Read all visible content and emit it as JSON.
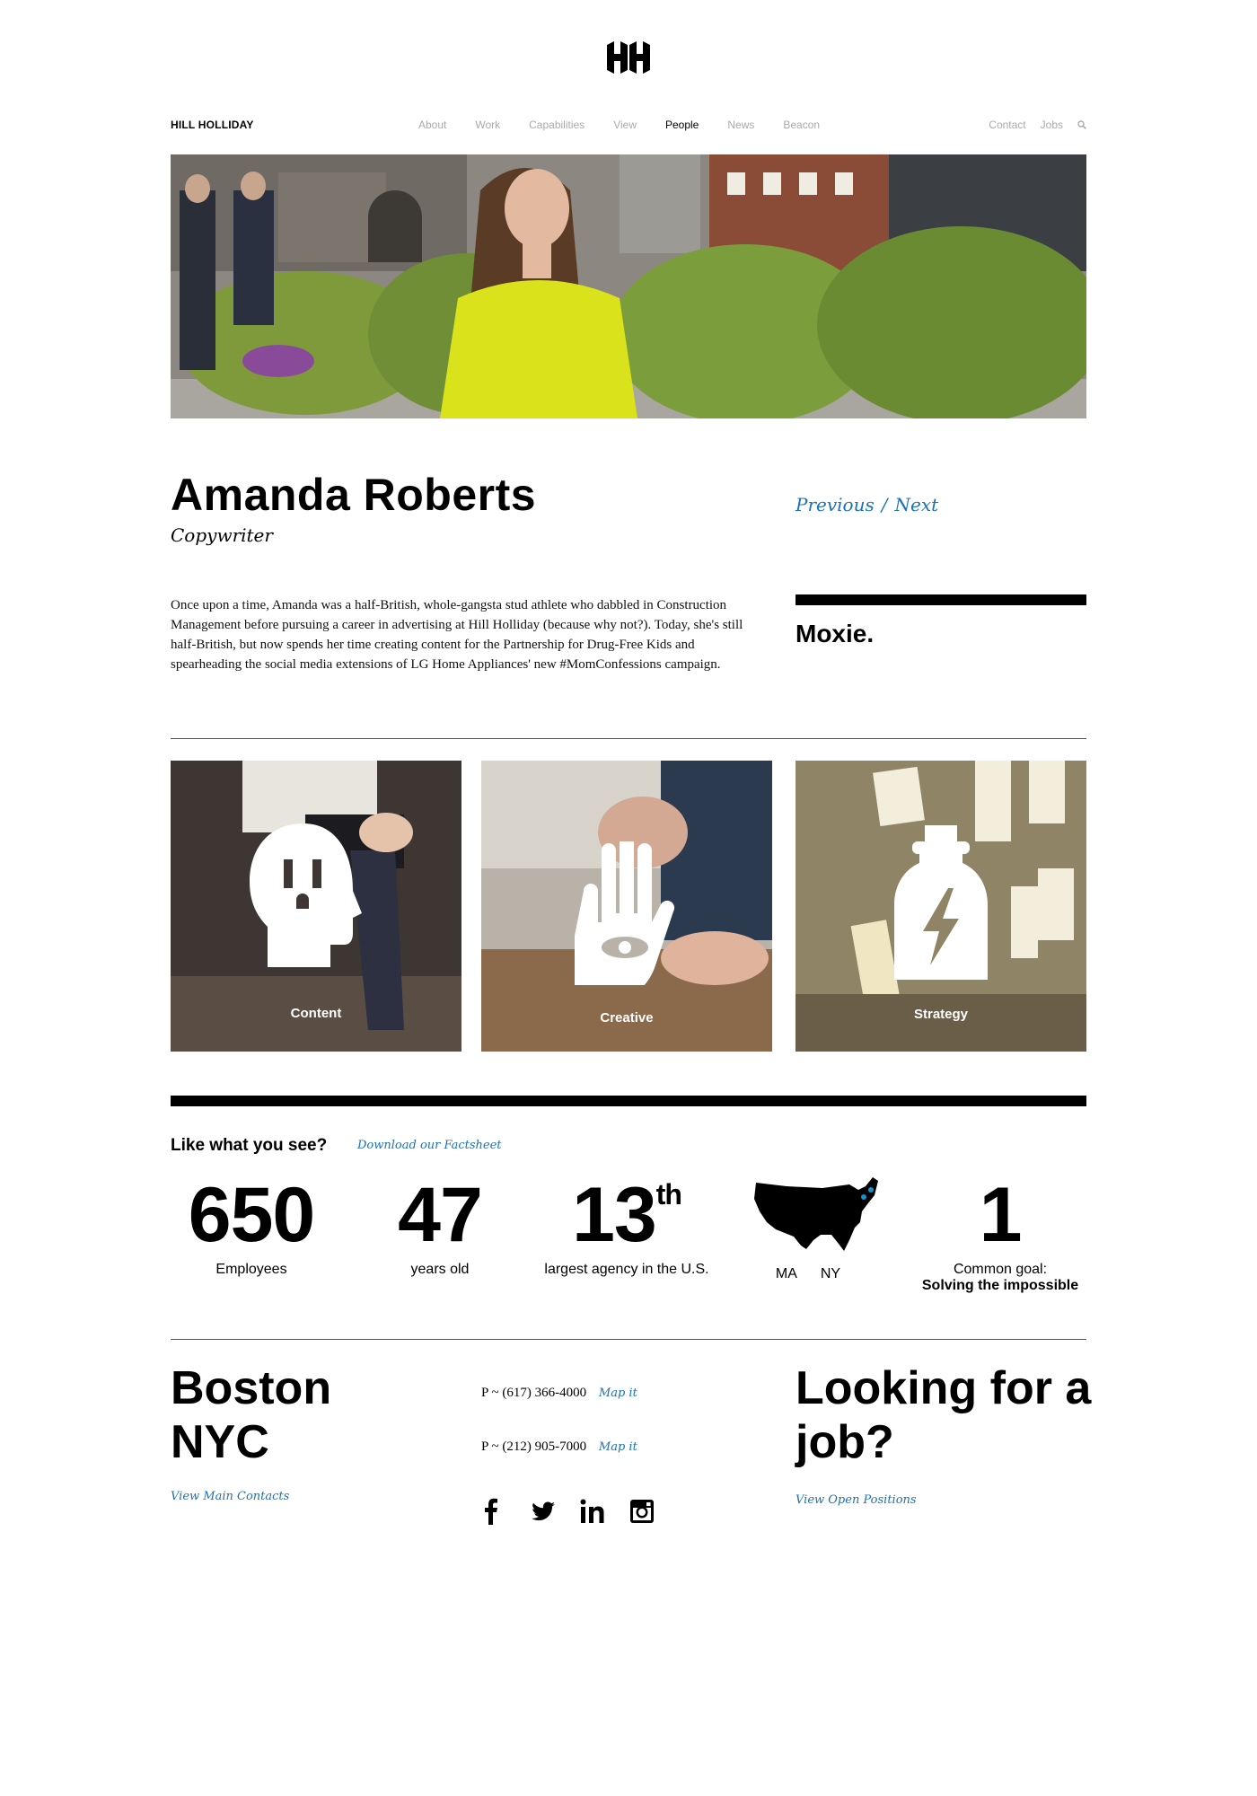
{
  "header": {
    "brand": "HILL HOLLIDAY",
    "nav_main": [
      "About",
      "Work",
      "Capabilities",
      "View",
      "People",
      "News",
      "Beacon"
    ],
    "nav_active": "People",
    "nav_right": [
      "Contact",
      "Jobs"
    ],
    "icons": {
      "logo": "hh-logo-icon",
      "search": "search-icon"
    }
  },
  "profile": {
    "name": "Amanda Roberts",
    "title": "Copywriter",
    "previous_label": "Previous",
    "separator": "/",
    "next_label": "Next",
    "bio": "Once upon a time, Amanda was a half-British, whole-gangsta stud athlete who dabbled in Construction Management before pursuing a career in advertising at Hill Holliday (because why not?). Today, she's still half-British, but now spends her time creating content for the Partnership for Drug-Free Kids and spearheading the social media extensions of LG Home Appliances' new #MomConfessions campaign.",
    "trait": "Moxie."
  },
  "capabilities": [
    {
      "label": "Content",
      "icon": "outlet-head-icon"
    },
    {
      "label": "Creative",
      "icon": "hand-eye-icon"
    },
    {
      "label": "Strategy",
      "icon": "lightning-bottle-icon"
    }
  ],
  "facts": {
    "title": "Like what you see?",
    "download_link": "Download our Factsheet",
    "employees": {
      "value": "650",
      "label": "Employees"
    },
    "age": {
      "value": "47",
      "label": "years old"
    },
    "rank": {
      "value": "13",
      "suffix": "th",
      "label": "largest agency in the U.S."
    },
    "locations": {
      "icon": "us-map-icon",
      "label_1": "MA",
      "label_2": "NY"
    },
    "goal": {
      "value": "1",
      "label": "Common goal:",
      "label_bold": "Solving the impossible"
    }
  },
  "footer": {
    "city_1": "Boston",
    "city_2": "NYC",
    "contacts_link": "View Main Contacts",
    "phone_1": "P ~ (617) 366-4000",
    "phone_2": "P ~ (212) 905-7000",
    "map_link": "Map it",
    "job_title": "Looking for a job?",
    "positions_link": "View Open Positions",
    "social": [
      "facebook-icon",
      "twitter-icon",
      "linkedin-icon",
      "instagram-icon"
    ]
  },
  "colors": {
    "link": "#1a72b8",
    "text": "#000000",
    "nav_muted": "#aaaaaa"
  }
}
